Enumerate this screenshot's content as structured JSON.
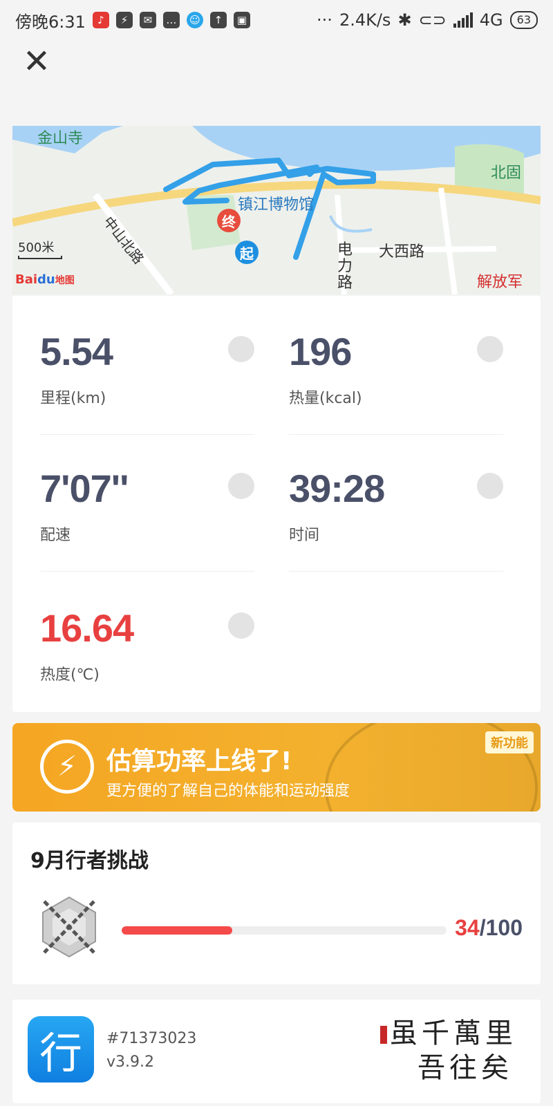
{
  "status_bar": {
    "time": "傍晚6:31",
    "net_speed": "2.4K/s",
    "network": "4G",
    "battery": "63",
    "dots": "···"
  },
  "map": {
    "places": [
      "金山寺",
      "镇江博物馆",
      "北固",
      "大西路",
      "电力路",
      "中山北路",
      "解放军"
    ],
    "end_marker": "终",
    "start_marker": "起",
    "scale": "500米",
    "logo_bai": "Bai",
    "logo_du": "du",
    "logo_map": "地图"
  },
  "stats": {
    "distance": {
      "value": "5.54",
      "label": "里程(km)"
    },
    "calories": {
      "value": "196",
      "label": "热量(kcal)"
    },
    "pace": {
      "value": "7'07''",
      "label": "配速"
    },
    "time": {
      "value": "39:28",
      "label": "时间"
    },
    "heat": {
      "value": "16.64",
      "label": "热度(℃)"
    }
  },
  "banner": {
    "title": "估算功率上线了!",
    "subtitle": "更方便的了解自己的体能和运动强度",
    "badge": "新功能"
  },
  "challenge": {
    "title": "9月行者挑战",
    "current": "34",
    "separator": "/",
    "target": "100",
    "progress": 0.34
  },
  "app": {
    "icon_char": "行",
    "id": "#71373023",
    "version": "v3.9.2",
    "calligraphy_line1": "虽千萬里",
    "calligraphy_line2": "吾往矣"
  }
}
